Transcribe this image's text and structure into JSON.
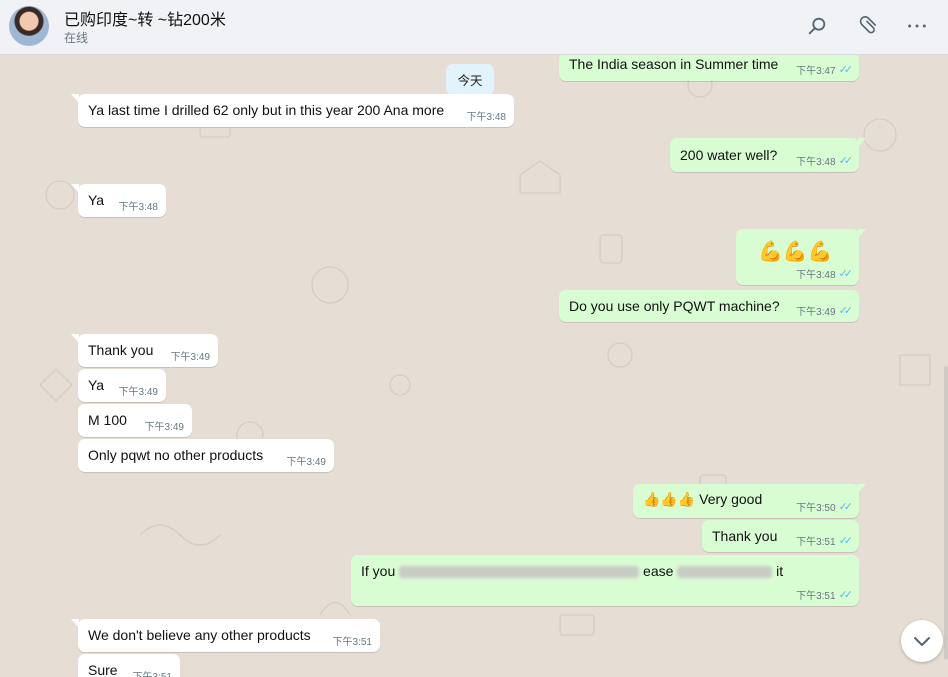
{
  "header": {
    "contact_name": "已购印度~转      ~钻200米",
    "status": "在线",
    "icons": [
      "search-icon",
      "attach-icon",
      "more-icon"
    ]
  },
  "chat": {
    "date_chip": "今天",
    "messages": [
      {
        "dir": "out",
        "text": "The India season in Summer time",
        "time": "下午3:47"
      },
      {
        "dir": "in",
        "text": "Ya last time I drilled 62 only but in this year 200 Ana more",
        "time": "下午3:48"
      },
      {
        "dir": "out",
        "text": "200 water well?",
        "time": "下午3:48"
      },
      {
        "dir": "in",
        "text": "Ya",
        "time": "下午3:48"
      },
      {
        "dir": "out",
        "text": "💪💪💪",
        "time": "下午3:48"
      },
      {
        "dir": "out",
        "text": "Do you use only PQWT machine?",
        "time": "下午3:49"
      },
      {
        "dir": "in",
        "text": "Thank you",
        "time": "下午3:49"
      },
      {
        "dir": "in",
        "text": "Ya",
        "time": "下午3:49"
      },
      {
        "dir": "in",
        "text": "M 100",
        "time": "下午3:49"
      },
      {
        "dir": "in",
        "text": "Only pqwt no other products",
        "time": "下午3:49"
      },
      {
        "dir": "out",
        "text": "👍👍👍 Very good",
        "time": "下午3:50"
      },
      {
        "dir": "out",
        "text": "Thank you",
        "time": "下午3:51"
      },
      {
        "dir": "out",
        "text_parts": [
          "If you",
          "ease",
          "it"
        ],
        "time": "下午3:51"
      },
      {
        "dir": "in",
        "text": "We don't believe any other products",
        "time": "下午3:51"
      },
      {
        "dir": "in",
        "text": "Sure",
        "time": "下午3:51"
      }
    ]
  },
  "colors": {
    "outgoing_bubble": "#d9fdd3",
    "incoming_bubble": "#ffffff",
    "read_ticks": "#53bdeb",
    "chat_background": "#e6ded5"
  }
}
